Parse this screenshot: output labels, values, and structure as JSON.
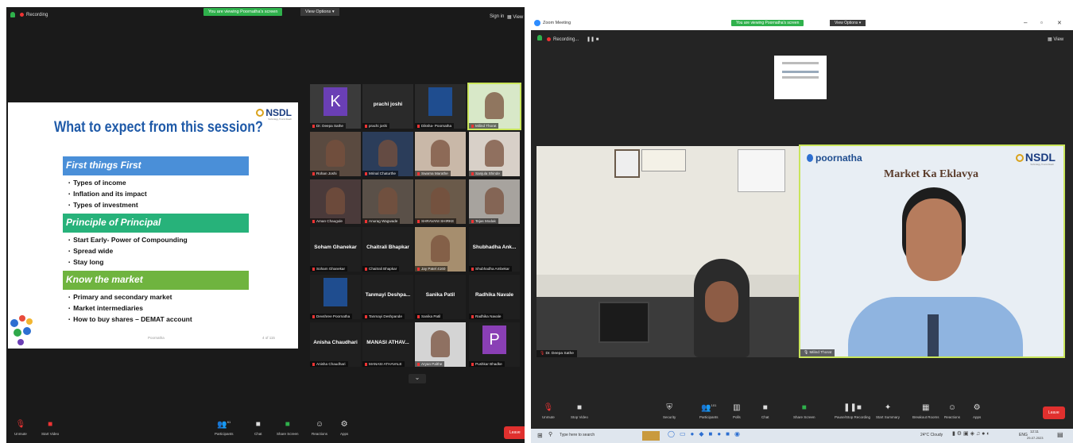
{
  "left_window": {
    "recording": "Recording",
    "banner": "You are viewing Poornatha's screen",
    "view_options": "View Options",
    "view_options_caret": "▾",
    "sign_in": "Sign in",
    "view": "View",
    "slide": {
      "title": "What to expect from this session?",
      "logo": "NSDL",
      "logo_tagline": "Technology, Trust & Reach",
      "sections": [
        {
          "heading": "First things First",
          "color": "#4a8fd8",
          "bullets": [
            "Types of income",
            "Inflation and its impact",
            "Types of investment"
          ]
        },
        {
          "heading": "Principle of Principal",
          "color": "#27b27a",
          "bullets": [
            "Start Early- Power of Compounding",
            "Spread wide",
            "Stay long"
          ]
        },
        {
          "heading": "Know the market",
          "color": "#6fb43f",
          "bullets": [
            "Primary and secondary market",
            "Market intermediaries",
            "How to buy shares – DEMAT account"
          ]
        }
      ],
      "footer_center": "Poornatha",
      "footer_page": "4 of 115"
    },
    "tiles": [
      {
        "name": "Dr. Deepa Sathe",
        "big": "",
        "avatar": "K",
        "avatar_color": "#6a3fb5"
      },
      {
        "name": "prachi joshi",
        "big": "prachi joshi",
        "avatar": "",
        "avatar_color": ""
      },
      {
        "name": "Diksha- Poornatha",
        "big": "",
        "avatar": "",
        "avatar_color": "#1f4d8f"
      },
      {
        "name": "Milind Thorat",
        "big": "",
        "avatar": "",
        "avatar_color": ""
      },
      {
        "name": "Rohan Joshi",
        "big": "",
        "avatar": "",
        "avatar_color": ""
      },
      {
        "name": "Mrinal Chaturthe",
        "big": "",
        "avatar": "",
        "avatar_color": ""
      },
      {
        "name": "Swarna Marathe",
        "big": "",
        "avatar": "",
        "avatar_color": ""
      },
      {
        "name": "Sanjula Shinde",
        "big": "",
        "avatar": "",
        "avatar_color": ""
      },
      {
        "name": "Aman Chaugule",
        "big": "",
        "avatar": "",
        "avatar_color": ""
      },
      {
        "name": "Anurag Wagwade",
        "big": "",
        "avatar": "",
        "avatar_color": ""
      },
      {
        "name": "SHRAVANI SHIRKE",
        "big": "",
        "avatar": "",
        "avatar_color": ""
      },
      {
        "name": "Tejas Modak",
        "big": "",
        "avatar": "",
        "avatar_color": ""
      },
      {
        "name": "Soham Ghanekar",
        "big": "Soham Ghanekar",
        "avatar": "",
        "avatar_color": ""
      },
      {
        "name": "Chaitrali Bhapkar",
        "big": "Chaitrali Bhapkar",
        "avatar": "",
        "avatar_color": ""
      },
      {
        "name": "Jay Patel 4160",
        "big": "",
        "avatar": "",
        "avatar_color": ""
      },
      {
        "name": "Shubhadha Ambekar",
        "big": "Shubhadha Ank...",
        "avatar": "",
        "avatar_color": ""
      },
      {
        "name": "Devshree Poornatha",
        "big": "",
        "avatar": "",
        "avatar_color": "#1f4d8f"
      },
      {
        "name": "Tanmayi Deshpande",
        "big": "Tanmayi Deshpa...",
        "avatar": "",
        "avatar_color": ""
      },
      {
        "name": "Sanika Patil",
        "big": "Sanika Patil",
        "avatar": "",
        "avatar_color": ""
      },
      {
        "name": "Radhika Navale",
        "big": "Radhika Navale",
        "avatar": "",
        "avatar_color": ""
      },
      {
        "name": "Anisha Chaudhari",
        "big": "Anisha Chaudhari",
        "avatar": "",
        "avatar_color": ""
      },
      {
        "name": "MANASI ATHAVALE",
        "big": "MANASI ATHAV...",
        "avatar": "",
        "avatar_color": ""
      },
      {
        "name": "Aryan Palthe",
        "big": "",
        "avatar": "",
        "avatar_color": ""
      },
      {
        "name": "Pushkar Bhadke",
        "big": "",
        "avatar": "P",
        "avatar_color": "#8a3fb5"
      }
    ],
    "more_chevron": "⌄",
    "toolbar": {
      "unmute": "Unmute",
      "start_video": "Start Video",
      "participants": "Participants",
      "participants_count": "61",
      "chat": "Chat",
      "share_screen": "Share Screen",
      "reactions": "Reactions",
      "apps": "Apps",
      "leave": "Leave"
    }
  },
  "right_window": {
    "title": "Zoom Meeting",
    "banner": "You are viewing Poornatha's screen",
    "view_options": "View Options",
    "view_options_caret": "▾",
    "recording": "Recording...",
    "view": "View",
    "window_controls": {
      "minimize": "–",
      "maximize": "▫",
      "close": "✕"
    },
    "left_cam_label": "Dr. Deepa Sathe",
    "right_cam_label": "Milind Thorat",
    "right_cam": {
      "brand": "poornatha",
      "logo": "NSDL",
      "logo_tagline": "Technology, Trust & Reach",
      "heading": "Market Ka Eklavya"
    },
    "toolbar": {
      "unmute": "Unmute",
      "stop_video": "Stop Video",
      "security": "Security",
      "participants": "Participants",
      "participants_count": "101",
      "polls": "Polls",
      "chat": "Chat",
      "share_screen": "Share Screen",
      "pause_stop_recording": "Pause/Stop Recording",
      "start_summary": "Start Summary",
      "breakout_rooms": "Breakout Rooms",
      "reactions": "Reactions",
      "apps": "Apps",
      "leave": "Leave"
    },
    "taskbar": {
      "search_placeholder": "Type here to search",
      "weather": "24°C Cloudy",
      "lang": "ENG",
      "time": "12:11",
      "date": "29-07-2023"
    }
  }
}
